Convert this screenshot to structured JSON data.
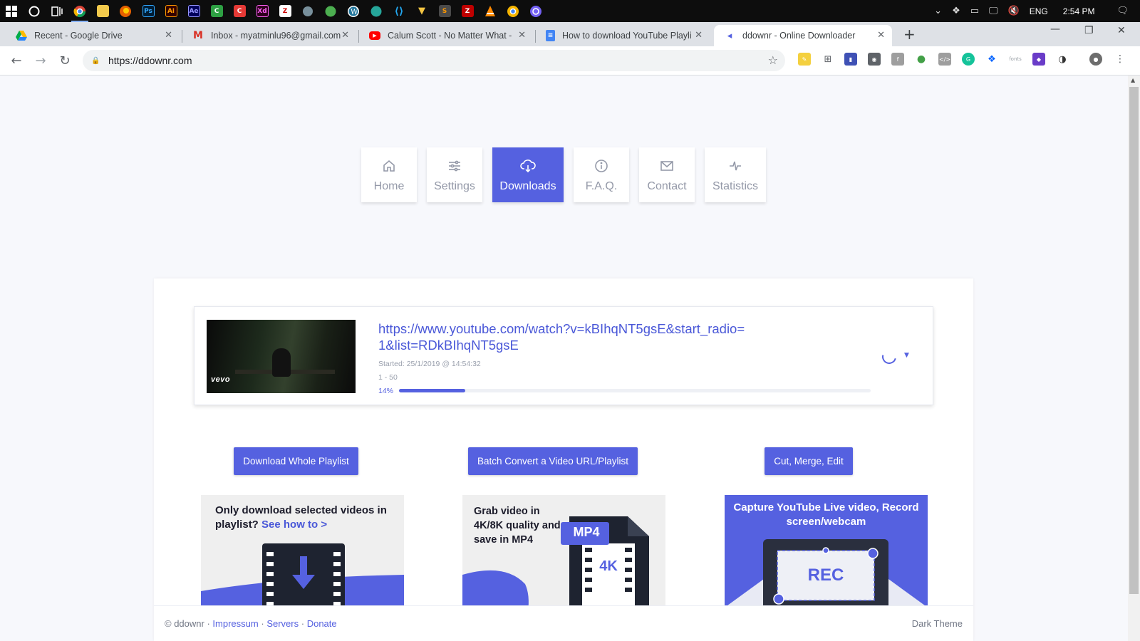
{
  "taskbar": {
    "language": "ENG",
    "time": "2:54 PM"
  },
  "tabs": [
    {
      "title": "Recent - Google Drive",
      "favicon": "google-drive-icon"
    },
    {
      "title": "Inbox - myatminlu96@gmail.com",
      "favicon": "gmail-icon"
    },
    {
      "title": "Calum Scott - No Matter What -",
      "favicon": "youtube-icon"
    },
    {
      "title": "How to download YouTube Playli",
      "favicon": "google-docs-icon"
    },
    {
      "title": "ddownr - Online Downloader",
      "favicon": "ddownr-icon"
    }
  ],
  "toolbar": {
    "url": "https://ddownr.com",
    "ext_fonts_label": "fonts"
  },
  "nav": [
    {
      "label": "Home",
      "icon": "home-icon"
    },
    {
      "label": "Settings",
      "icon": "sliders-icon"
    },
    {
      "label": "Downloads",
      "icon": "cloud-download-icon"
    },
    {
      "label": "F.A.Q.",
      "icon": "info-icon"
    },
    {
      "label": "Contact",
      "icon": "mail-icon"
    },
    {
      "label": "Statistics",
      "icon": "activity-icon"
    }
  ],
  "download": {
    "url": "https://www.youtube.com/watch?v=kBIhqNT5gsE&start_radio=1&list=RDkBIhqNT5gsE",
    "started": "Started: 25/1/2019 @ 14:54:32",
    "range": "1 - 50",
    "progress_label": "14%",
    "progress": 0.14,
    "thumb_brand": "vevo"
  },
  "actions": {
    "download_playlist": "Download Whole Playlist",
    "batch_convert": "Batch Convert a Video URL/Playlist",
    "cut_merge": "Cut, Merge, Edit"
  },
  "promos": {
    "p1_title": "Only download selected videos in playlist?",
    "p1_link": "See how to >",
    "p2_title": "Grab video in 4K/8K quality and save in MP4",
    "p2_badge": "MP4",
    "p2_file": "4K",
    "p3_title": "Capture YouTube Live video, Record screen/webcam",
    "p3_rec": "REC"
  },
  "footer": {
    "copyright": "© ddownr",
    "impressum": "Impressum",
    "servers": "Servers",
    "donate": "Donate",
    "sep": "·",
    "dark_theme": "Dark Theme"
  },
  "colors": {
    "accent": "#5561e0",
    "link": "#4a58d8"
  }
}
